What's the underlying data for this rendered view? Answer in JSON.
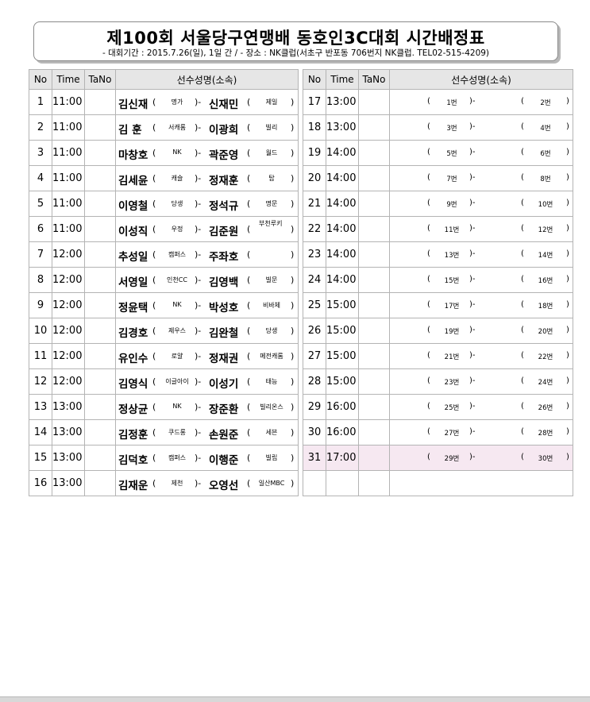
{
  "header": {
    "title": "제100회 서울당구연맹배 동호인3C대회 시간배정표",
    "subtitle": "- 대회기간 : 2015.7.26(일), 1일 간 / - 장소 : NK클럽(서초구 반포동 706번지 NK클럽. TEL02-515-4209)"
  },
  "columns": {
    "no": "No",
    "time": "Time",
    "tano": "TaNo",
    "players": "선수성명(소속)"
  },
  "left": [
    {
      "no": "1",
      "time": "11:00",
      "p1": "김신재",
      "c1": "명가",
      "p2": "신재민",
      "c2": "제일"
    },
    {
      "no": "2",
      "time": "11:00",
      "p1": "김  훈",
      "c1": "서캐롬",
      "p2": "이광희",
      "c2": "빌리"
    },
    {
      "no": "3",
      "time": "11:00",
      "p1": "마창호",
      "c1": "NK",
      "p2": "곽준영",
      "c2": "월드"
    },
    {
      "no": "4",
      "time": "11:00",
      "p1": "김세윤",
      "c1": "캐슬",
      "p2": "정재훈",
      "c2": "탑"
    },
    {
      "no": "5",
      "time": "11:00",
      "p1": "이영철",
      "c1": "당생",
      "p2": "정석규",
      "c2": "명문"
    },
    {
      "no": "6",
      "time": "11:00",
      "p1": "이성직",
      "c1": "우정",
      "p2": "김준원",
      "c2": "부천루키"
    },
    {
      "no": "7",
      "time": "12:00",
      "p1": "추성일",
      "c1": "캠퍼스",
      "p2": "주좌호",
      "c2": ""
    },
    {
      "no": "8",
      "time": "12:00",
      "p1": "서영일",
      "c1": "인천CC",
      "p2": "김영백",
      "c2": "빌문"
    },
    {
      "no": "9",
      "time": "12:00",
      "p1": "정윤택",
      "c1": "NK",
      "p2": "박성호",
      "c2": "비바체"
    },
    {
      "no": "10",
      "time": "12:00",
      "p1": "김경호",
      "c1": "제우스",
      "p2": "김완철",
      "c2": "당생"
    },
    {
      "no": "11",
      "time": "12:00",
      "p1": "유인수",
      "c1": "로얄",
      "p2": "정재권",
      "c2": "메전캐롬"
    },
    {
      "no": "12",
      "time": "12:00",
      "p1": "김영식",
      "c1": "이글아이",
      "p2": "이성기",
      "c2": "태능"
    },
    {
      "no": "13",
      "time": "13:00",
      "p1": "정상균",
      "c1": "NK",
      "p2": "장준환",
      "c2": "빌리온스"
    },
    {
      "no": "14",
      "time": "13:00",
      "p1": "김정훈",
      "c1": "쿠드롱",
      "p2": "손원준",
      "c2": "세븐"
    },
    {
      "no": "15",
      "time": "13:00",
      "p1": "김덕호",
      "c1": "캠퍼스",
      "p2": "이행준",
      "c2": "빌립"
    },
    {
      "no": "16",
      "time": "13:00",
      "p1": "김재운",
      "c1": "제천",
      "p2": "오영선",
      "c2": "일산MBC"
    }
  ],
  "right": [
    {
      "no": "17",
      "time": "13:00",
      "s1": "1번",
      "s2": "2번"
    },
    {
      "no": "18",
      "time": "13:00",
      "s1": "3번",
      "s2": "4번"
    },
    {
      "no": "19",
      "time": "14:00",
      "s1": "5번",
      "s2": "6번"
    },
    {
      "no": "20",
      "time": "14:00",
      "s1": "7번",
      "s2": "8번"
    },
    {
      "no": "21",
      "time": "14:00",
      "s1": "9번",
      "s2": "10번"
    },
    {
      "no": "22",
      "time": "14:00",
      "s1": "11번",
      "s2": "12번"
    },
    {
      "no": "23",
      "time": "14:00",
      "s1": "13번",
      "s2": "14번"
    },
    {
      "no": "24",
      "time": "14:00",
      "s1": "15번",
      "s2": "16번"
    },
    {
      "no": "25",
      "time": "15:00",
      "s1": "17번",
      "s2": "18번"
    },
    {
      "no": "26",
      "time": "15:00",
      "s1": "19번",
      "s2": "20번"
    },
    {
      "no": "27",
      "time": "15:00",
      "s1": "21번",
      "s2": "22번"
    },
    {
      "no": "28",
      "time": "15:00",
      "s1": "23번",
      "s2": "24번"
    },
    {
      "no": "29",
      "time": "16:00",
      "s1": "25번",
      "s2": "26번"
    },
    {
      "no": "30",
      "time": "16:00",
      "s1": "27번",
      "s2": "28번"
    },
    {
      "no": "31",
      "time": "17:00",
      "s1": "29번",
      "s2": "30번",
      "highlight": true
    }
  ],
  "colors": {
    "header_bg": "#e6e6e6",
    "grid": "#b4b4b4",
    "highlight_row": "#f6e8f1"
  }
}
